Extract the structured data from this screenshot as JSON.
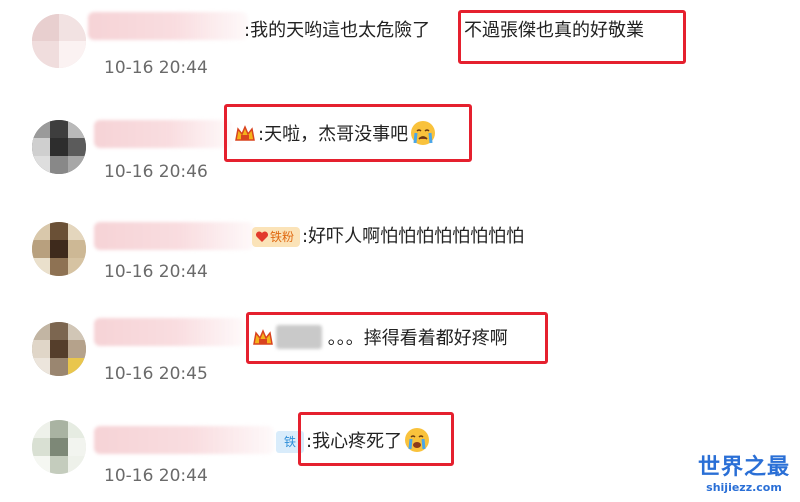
{
  "comments": [
    {
      "text": ":我的天哟這也太危險了",
      "highlight_text": "不過張傑也真的好敬業",
      "time": "10-16 20:44"
    },
    {
      "text": ":天啦，杰哥没事吧",
      "time": "10-16 20:46"
    },
    {
      "badge": "铁粉",
      "text": ":好吓人啊怕怕怕怕怕怕怕怕",
      "time": "10-16 20:44"
    },
    {
      "text": "。。。摔得看着都好疼啊",
      "time": "10-16 20:45"
    },
    {
      "badge": "铁",
      "text": ":我心疼死了",
      "time": "10-16 20:44"
    }
  ],
  "emojis": [
    "crying-face-emoji",
    "crying-face-emoji"
  ],
  "watermark": {
    "main": "世界之最",
    "sub": "shijiezz.com"
  },
  "colors": {
    "highlight": "#e5202e",
    "timestamp": "#6a6a6a",
    "watermark": "#2a6fd6"
  }
}
